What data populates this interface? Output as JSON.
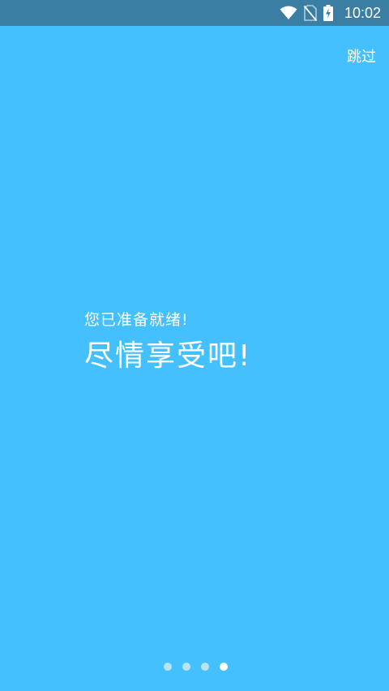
{
  "status_bar": {
    "time": "10:02",
    "icons": [
      "wifi-icon",
      "no-sim-icon",
      "battery-charging-icon"
    ],
    "color": "#3A7FA3"
  },
  "header": {
    "skip_label": "跳过"
  },
  "main": {
    "line1": "您已准备就绪!",
    "line2": "尽情享受吧!",
    "background": "#44C0FE"
  },
  "pager": {
    "total": 4,
    "active_index": 3
  }
}
